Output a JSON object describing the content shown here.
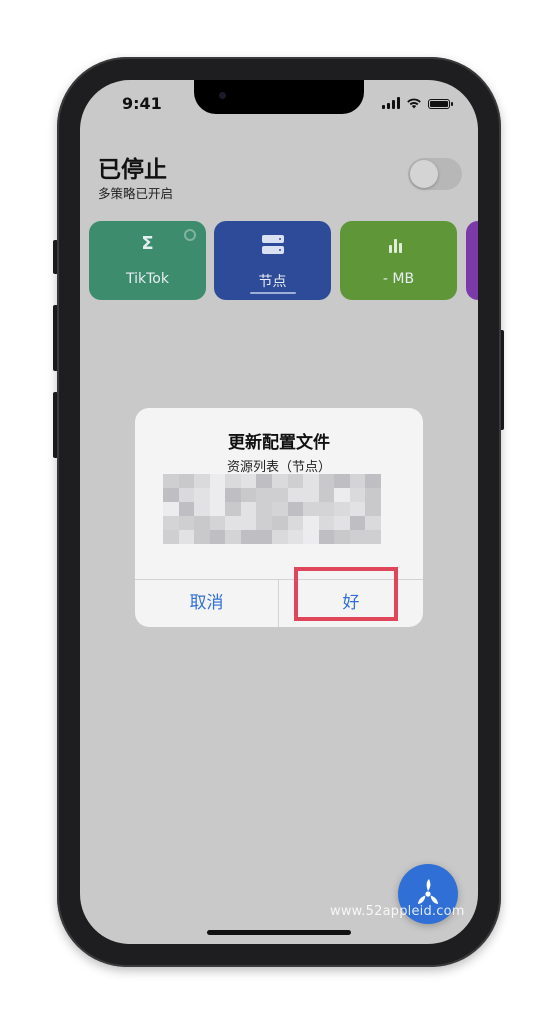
{
  "status_bar": {
    "time": "9:41"
  },
  "header": {
    "title": "已停止",
    "subtitle": "多策略已开启",
    "toggle_on": false
  },
  "tiles": [
    {
      "label": "TikTok",
      "icon": "sigma-icon",
      "color": "#3d8c6e"
    },
    {
      "label": "节点",
      "icon": "server-icon",
      "color": "#2e4b9a"
    },
    {
      "label": "- MB",
      "icon": "bar-chart-icon",
      "color": "#5e9638"
    },
    {
      "label": "",
      "icon": "",
      "color": "#7b3aa8"
    }
  ],
  "dialog": {
    "title": "更新配置文件",
    "message": "资源列表（节点）",
    "cancel_label": "取消",
    "ok_label": "好"
  },
  "fab": {
    "icon": "fan-icon",
    "color": "#2f6fd6"
  },
  "watermark": "www.52appleid.com",
  "colors": {
    "highlight": "#e0465a",
    "accent": "#2f6fd6"
  }
}
